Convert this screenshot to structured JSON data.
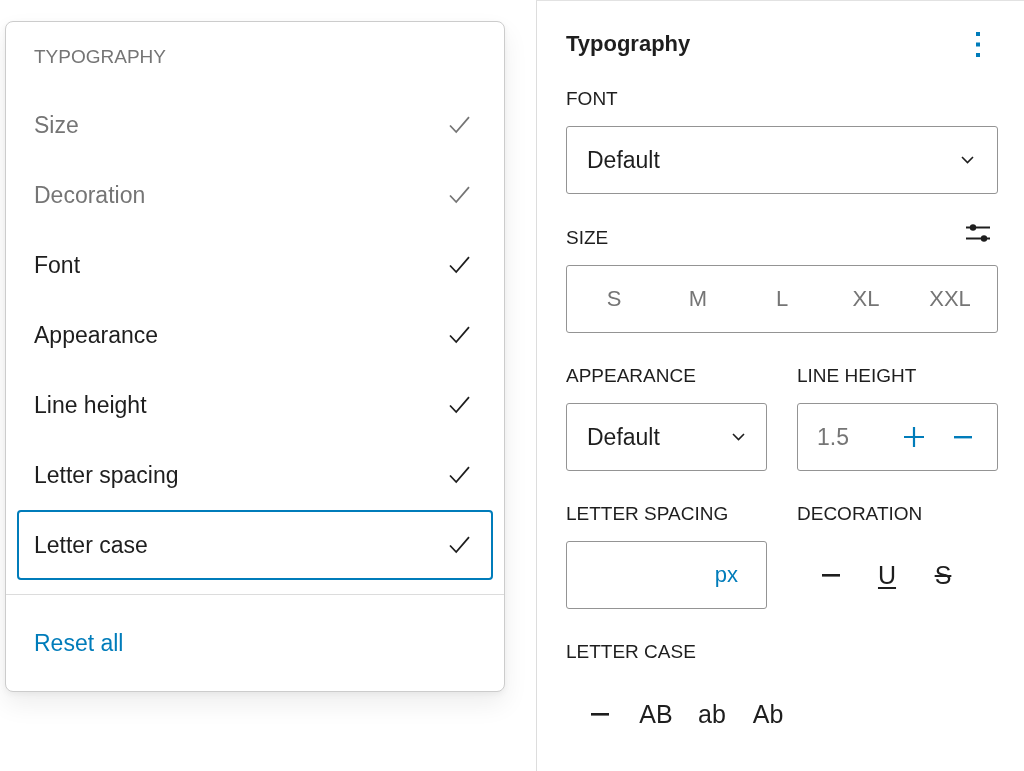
{
  "menu": {
    "heading": "TYPOGRAPHY",
    "items": [
      {
        "label": "Size",
        "checked": true,
        "disabled": true,
        "focused": false
      },
      {
        "label": "Decoration",
        "checked": true,
        "disabled": true,
        "focused": false
      },
      {
        "label": "Font",
        "checked": true,
        "disabled": false,
        "focused": false
      },
      {
        "label": "Appearance",
        "checked": true,
        "disabled": false,
        "focused": false
      },
      {
        "label": "Line height",
        "checked": true,
        "disabled": false,
        "focused": false
      },
      {
        "label": "Letter spacing",
        "checked": true,
        "disabled": false,
        "focused": false
      },
      {
        "label": "Letter case",
        "checked": true,
        "disabled": false,
        "focused": true
      }
    ],
    "reset_label": "Reset all"
  },
  "panel": {
    "title": "Typography",
    "font": {
      "label": "FONT",
      "value": "Default"
    },
    "size": {
      "label": "SIZE",
      "options": [
        {
          "label": "S",
          "selected": false
        },
        {
          "label": "M",
          "selected": false
        },
        {
          "label": "L",
          "selected": false
        },
        {
          "label": "XL",
          "selected": false
        },
        {
          "label": "XXL",
          "selected": false
        }
      ]
    },
    "appearance": {
      "label": "APPEARANCE",
      "value": "Default"
    },
    "line_height": {
      "label": "LINE HEIGHT",
      "placeholder": "1.5"
    },
    "letter_spacing": {
      "label": "LETTER SPACING",
      "unit": "px"
    },
    "decoration": {
      "label": "DECORATION",
      "options": [
        {
          "kind": "none",
          "selected": false
        },
        {
          "kind": "underline",
          "glyph": "U",
          "selected": false
        },
        {
          "kind": "line-through",
          "glyph": "S",
          "selected": false
        }
      ]
    },
    "letter_case": {
      "label": "LETTER CASE",
      "options": [
        {
          "kind": "none",
          "selected": false
        },
        {
          "kind": "text",
          "glyph": "AB",
          "selected": false
        },
        {
          "kind": "text",
          "glyph": "ab",
          "selected": false
        },
        {
          "kind": "text",
          "glyph": "Ab",
          "selected": false
        }
      ]
    }
  }
}
